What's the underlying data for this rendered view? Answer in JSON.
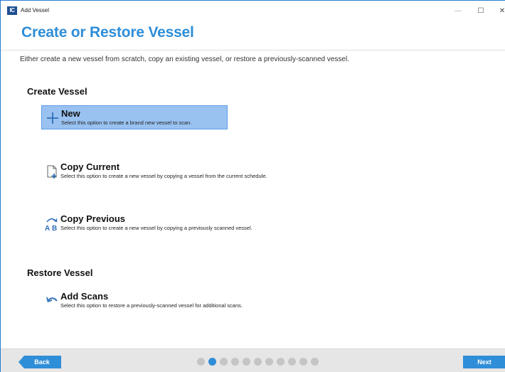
{
  "window": {
    "app_icon_text": "IC",
    "title": "Add Vessel",
    "minimize_glyph": "—",
    "maximize_glyph": "☐",
    "close_glyph": "✕"
  },
  "page": {
    "title": "Create or Restore Vessel",
    "subtitle": "Either create a new vessel from scratch, copy an existing vessel, or restore a previously-scanned vessel."
  },
  "create_section": {
    "heading": "Create Vessel",
    "options": [
      {
        "label": "New",
        "description": "Select this option to create a brand new vessel to scan.",
        "icon": "plus-icon",
        "selected": true
      },
      {
        "label": "Copy Current",
        "description": "Select this option to create a new vessel by copying a vessel from the current schedule.",
        "icon": "document-plus-icon",
        "selected": false
      },
      {
        "label": "Copy Previous",
        "description": "Select this option to create a new vessel by copying a previously scanned vessel.",
        "icon": "a-to-b-icon",
        "selected": false
      }
    ]
  },
  "restore_section": {
    "heading": "Restore Vessel",
    "options": [
      {
        "label": "Add Scans",
        "description": "Select this option to restore a previously-scanned vessel for additional scans.",
        "icon": "undo-arrow-icon",
        "selected": false
      }
    ]
  },
  "footer": {
    "back_label": "Back",
    "next_label": "Next",
    "step_total": 11,
    "step_current": 2
  },
  "colors": {
    "accent": "#2f8ed8",
    "selected_bg": "#99c2f1",
    "footer_bg": "#e6e6e6"
  }
}
